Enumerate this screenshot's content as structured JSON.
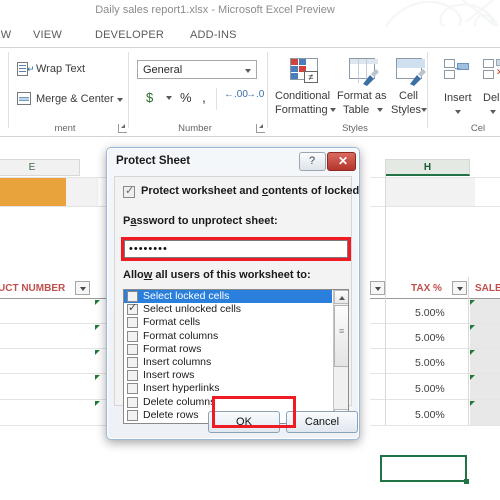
{
  "window": {
    "title": "Daily sales report1.xlsx - Microsoft Excel Preview"
  },
  "ribbon": {
    "tabs": [
      {
        "label": "IEW"
      },
      {
        "label": "VIEW"
      },
      {
        "label": "DEVELOPER"
      },
      {
        "label": "ADD-INS"
      }
    ],
    "groups": [
      {
        "label": "ment"
      },
      {
        "label": "Number"
      },
      {
        "label": "Styles"
      },
      {
        "label": "Cel"
      }
    ],
    "alignment": {
      "wrap_text": "Wrap Text",
      "merge_center": "Merge & Center"
    },
    "number": {
      "format_value": "General",
      "currency": "$",
      "percent": "%",
      "comma": ","
    },
    "styles": {
      "conditional_formatting_line1": "Conditional",
      "conditional_formatting_line2": "Formatting",
      "format_as_table_line1": "Format as",
      "format_as_table_line2": "Table",
      "cell_styles_line1": "Cell",
      "cell_styles_line2": "Styles"
    },
    "cells": {
      "insert": "Insert",
      "delete": "Dele"
    }
  },
  "sheet": {
    "column_headers": [
      {
        "label": "E",
        "selected": false
      },
      {
        "label": "H",
        "selected": true
      }
    ],
    "table_headers": [
      {
        "label": "UCT NUMBER"
      },
      {
        "label": "TAX %"
      },
      {
        "label": "SALE"
      }
    ],
    "tax_values": [
      "5.00%",
      "5.00%",
      "5.00%",
      "5.00%",
      "5.00%"
    ]
  },
  "dialog": {
    "title": "Protect Sheet",
    "help_glyph": "?",
    "close_glyph": "✕",
    "protect_checkbox": {
      "checked": true,
      "label_pre": "Protect worksheet and ",
      "label_accel": "c",
      "label_post": "ontents of locked cells"
    },
    "password_label_pre": "P",
    "password_label_accel": "a",
    "password_label_post": "ssword to unprotect sheet:",
    "password_value": "••••••••",
    "password_placeholder": "",
    "allow_label_pre": "Allo",
    "allow_label_accel": "w",
    "allow_label_post": " all users of this worksheet to:",
    "permissions": [
      {
        "label": "Select locked cells",
        "checked": false,
        "selected": true
      },
      {
        "label": "Select unlocked cells",
        "checked": true,
        "selected": false
      },
      {
        "label": "Format cells",
        "checked": false,
        "selected": false
      },
      {
        "label": "Format columns",
        "checked": false,
        "selected": false
      },
      {
        "label": "Format rows",
        "checked": false,
        "selected": false
      },
      {
        "label": "Insert columns",
        "checked": false,
        "selected": false
      },
      {
        "label": "Insert rows",
        "checked": false,
        "selected": false
      },
      {
        "label": "Insert hyperlinks",
        "checked": false,
        "selected": false
      },
      {
        "label": "Delete columns",
        "checked": false,
        "selected": false
      },
      {
        "label": "Delete rows",
        "checked": false,
        "selected": false
      }
    ],
    "ok_label": "OK",
    "cancel_label": "Cancel"
  },
  "colors": {
    "highlight_red": "#ee1b24",
    "excel_green": "#217346",
    "selection_blue": "#2a7fdd",
    "header_red": "#c0504d",
    "cell_orange": "#e8a33d",
    "close_red": "#b5352b"
  }
}
